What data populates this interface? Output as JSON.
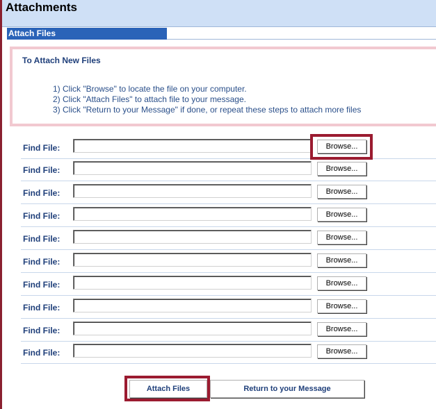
{
  "header": {
    "title": "Attachments"
  },
  "tab": {
    "label": "Attach Files"
  },
  "instructions": {
    "heading": "To Attach New Files",
    "steps": [
      "1) Click \"Browse\" to locate the file on your computer.",
      "2) Click \"Attach Files\" to attach file to your message.",
      "3) Click \"Return to your Message\" if done, or repeat these steps to attach more files"
    ]
  },
  "file_rows": [
    {
      "label": "Find File:",
      "value": "",
      "button": "Browse..."
    },
    {
      "label": "Find File:",
      "value": "",
      "button": "Browse..."
    },
    {
      "label": "Find File:",
      "value": "",
      "button": "Browse..."
    },
    {
      "label": "Find File:",
      "value": "",
      "button": "Browse..."
    },
    {
      "label": "Find File:",
      "value": "",
      "button": "Browse..."
    },
    {
      "label": "Find File:",
      "value": "",
      "button": "Browse..."
    },
    {
      "label": "Find File:",
      "value": "",
      "button": "Browse..."
    },
    {
      "label": "Find File:",
      "value": "",
      "button": "Browse..."
    },
    {
      "label": "Find File:",
      "value": "",
      "button": "Browse..."
    },
    {
      "label": "Find File:",
      "value": "",
      "button": "Browse..."
    }
  ],
  "actions": {
    "attach_label": "Attach Files",
    "return_label": "Return to your Message"
  },
  "colors": {
    "highlight": "#9b1b30",
    "tab": "#2a63b8",
    "header": "#cfe0f6"
  }
}
